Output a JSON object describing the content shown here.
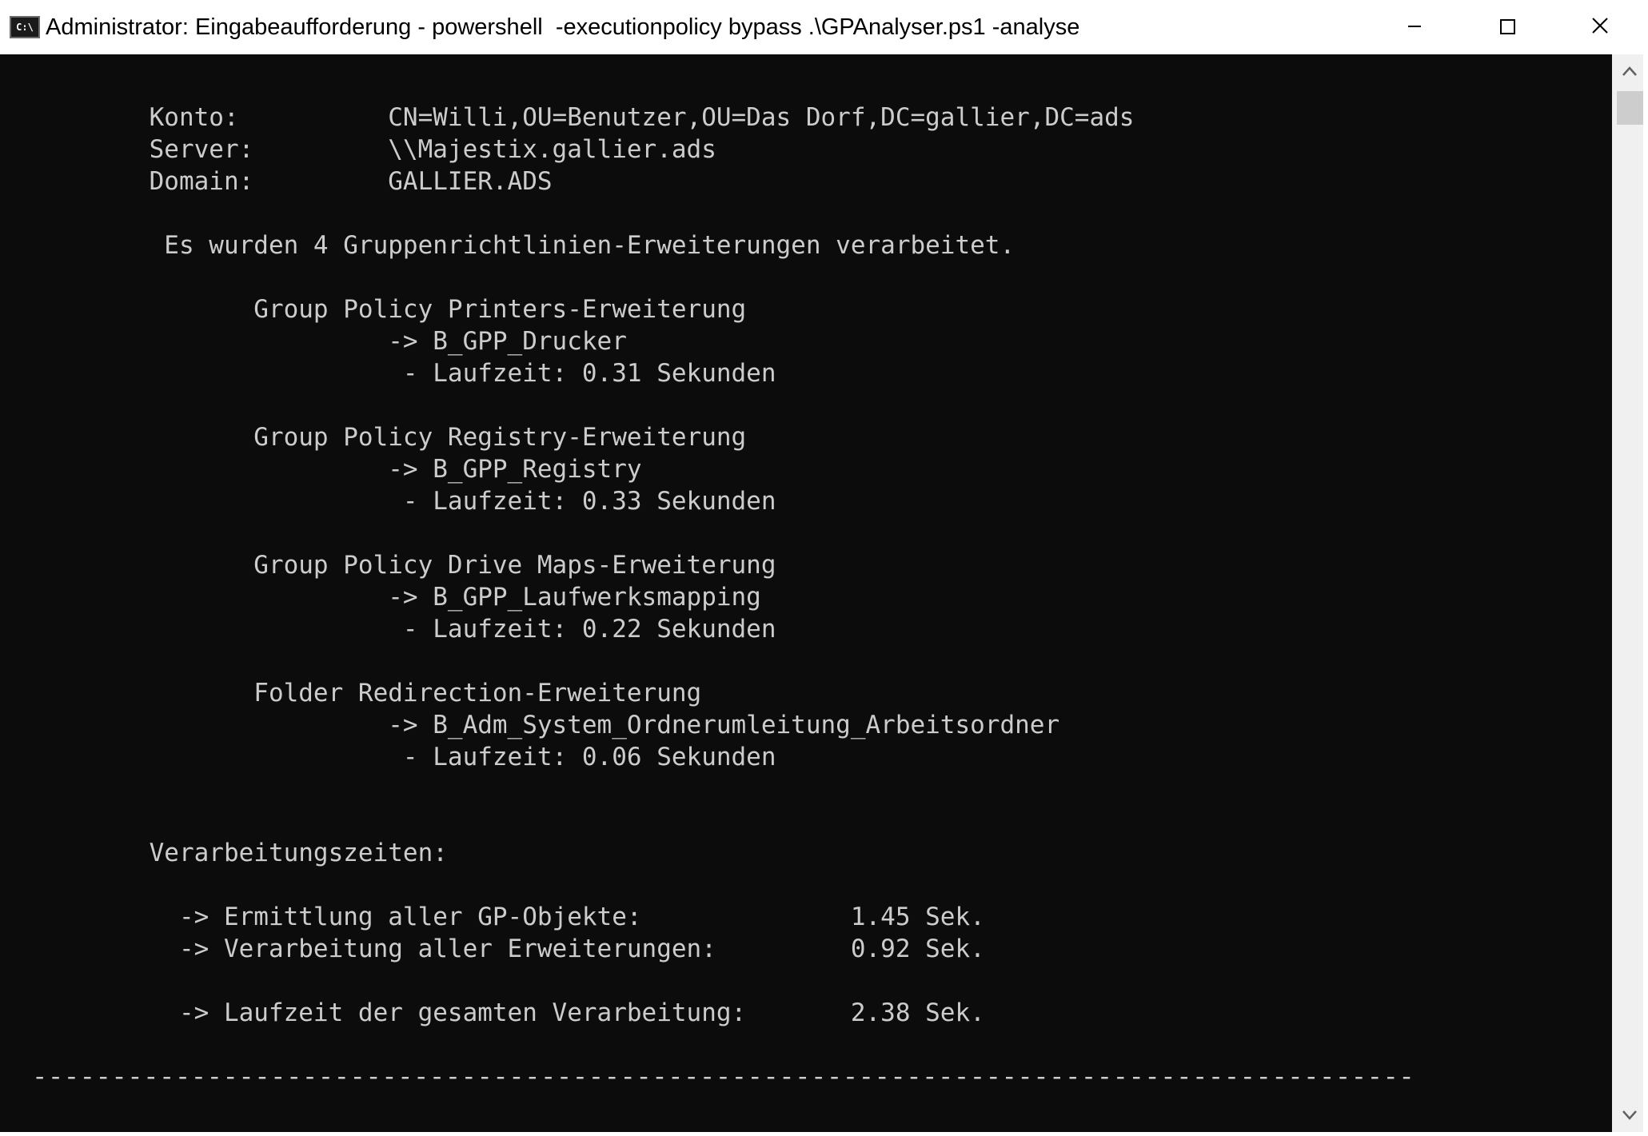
{
  "window": {
    "title": "Administrator: Eingabeaufforderung - powershell  -executionpolicy bypass .\\GPAnalyser.ps1 -analyse",
    "icon_glyph": "C:\\",
    "icon": "console-icon",
    "controls": {
      "minimize": "minimize-icon",
      "maximize": "maximize-icon",
      "close": "close-icon"
    }
  },
  "colors": {
    "console_background": "#0c0c0c",
    "console_text": "#cccccc",
    "titlebar_background": "#ffffff",
    "scrollbar_track": "#f0f0f0"
  },
  "console": {
    "lines": [
      "          Konto:          CN=Willi,OU=Benutzer,OU=Das Dorf,DC=gallier,DC=ads",
      "          Server:         \\\\Majestix.gallier.ads",
      "          Domain:         GALLIER.ADS",
      "",
      "           Es wurden 4 Gruppenrichtlinien-Erweiterungen verarbeitet.",
      "",
      "                 Group Policy Printers-Erweiterung",
      "                          -> B_GPP_Drucker",
      "                           - Laufzeit: 0.31 Sekunden",
      "",
      "                 Group Policy Registry-Erweiterung",
      "                          -> B_GPP_Registry",
      "                           - Laufzeit: 0.33 Sekunden",
      "",
      "                 Group Policy Drive Maps-Erweiterung",
      "                          -> B_GPP_Laufwerksmapping",
      "                           - Laufzeit: 0.22 Sekunden",
      "",
      "                 Folder Redirection-Erweiterung",
      "                          -> B_Adm_System_Ordnerumleitung_Arbeitsordner",
      "                           - Laufzeit: 0.06 Sekunden",
      "",
      "",
      "          Verarbeitungszeiten:",
      "",
      "            -> Ermittlung aller GP-Objekte:              1.45 Sek.",
      "            -> Verarbeitung aller Erweiterungen:         0.92 Sek.",
      "",
      "            -> Laufzeit der gesamten Verarbeitung:       2.38 Sek.",
      "",
      "  ---------------------------------------------------------------------------------------"
    ]
  }
}
